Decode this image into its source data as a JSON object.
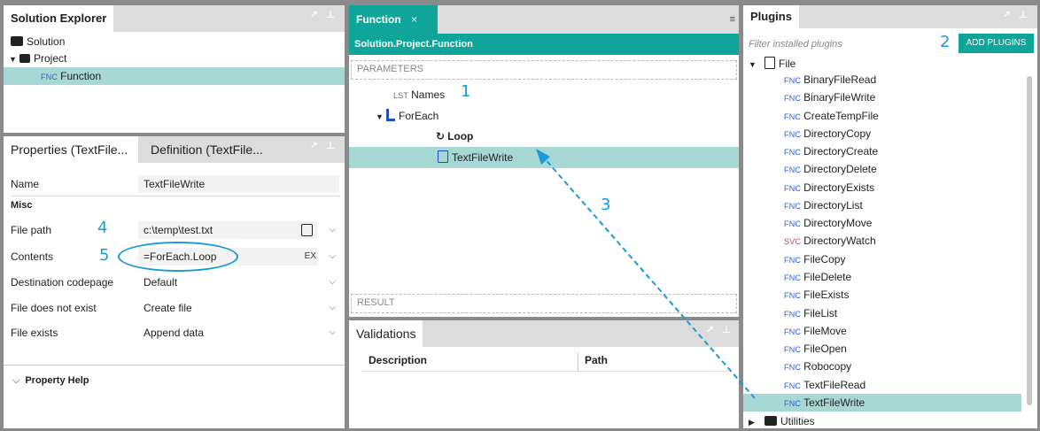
{
  "solution_explorer": {
    "title": "Solution Explorer",
    "solution_label": "Solution",
    "project_label": "Project",
    "function_tag": "FNC",
    "function_label": "Function"
  },
  "properties": {
    "tab_properties": "Properties (TextFile...",
    "tab_definition": "Definition (TextFile...",
    "name_label": "Name",
    "name_value": "TextFileWrite",
    "misc_label": "Misc",
    "rows": [
      {
        "label": "File path",
        "value": "c:\\temp\\test.txt",
        "badge": ""
      },
      {
        "label": "Contents",
        "value": "=ForEach.Loop",
        "badge": "EX"
      },
      {
        "label": "Destination codepage",
        "value": "Default",
        "badge": ""
      },
      {
        "label": "File does not exist",
        "value": "Create file",
        "badge": ""
      },
      {
        "label": "File exists",
        "value": "Append data",
        "badge": ""
      }
    ],
    "property_help": "Property Help"
  },
  "function_doc": {
    "tab_label": "Function",
    "tab_close": "×",
    "header": "Solution.Project.Function",
    "parameters_label": "PARAMETERS",
    "names_tag": "LST",
    "names_label": "Names",
    "foreach_label": "ForEach",
    "loop_label": "Loop",
    "textfilewrite_label": "TextFileWrite",
    "result_label": "RESULT"
  },
  "validations": {
    "title": "Validations",
    "col_description": "Description",
    "col_path": "Path"
  },
  "plugins": {
    "title": "Plugins",
    "filter_placeholder": "Filter installed plugins",
    "add_button": "ADD PLUGINS",
    "group_file": "File",
    "items": [
      {
        "tag": "FNC",
        "label": "BinaryFileRead"
      },
      {
        "tag": "FNC",
        "label": "BinaryFileWrite"
      },
      {
        "tag": "FNC",
        "label": "CreateTempFile"
      },
      {
        "tag": "FNC",
        "label": "DirectoryCopy"
      },
      {
        "tag": "FNC",
        "label": "DirectoryCreate"
      },
      {
        "tag": "FNC",
        "label": "DirectoryDelete"
      },
      {
        "tag": "FNC",
        "label": "DirectoryExists"
      },
      {
        "tag": "FNC",
        "label": "DirectoryList"
      },
      {
        "tag": "FNC",
        "label": "DirectoryMove"
      },
      {
        "tag": "SVC",
        "label": "DirectoryWatch"
      },
      {
        "tag": "FNC",
        "label": "FileCopy"
      },
      {
        "tag": "FNC",
        "label": "FileDelete"
      },
      {
        "tag": "FNC",
        "label": "FileExists"
      },
      {
        "tag": "FNC",
        "label": "FileList"
      },
      {
        "tag": "FNC",
        "label": "FileMove"
      },
      {
        "tag": "FNC",
        "label": "FileOpen"
      },
      {
        "tag": "FNC",
        "label": "Robocopy"
      },
      {
        "tag": "FNC",
        "label": "TextFileRead"
      },
      {
        "tag": "FNC",
        "label": "TextFileWrite"
      }
    ],
    "group_utilities": "Utilities"
  },
  "callouts": [
    "1",
    "2",
    "3",
    "4",
    "5"
  ],
  "colors": {
    "accent": "#0fa59a",
    "selection": "#a8d8d4",
    "callout": "#1a9ad6"
  }
}
